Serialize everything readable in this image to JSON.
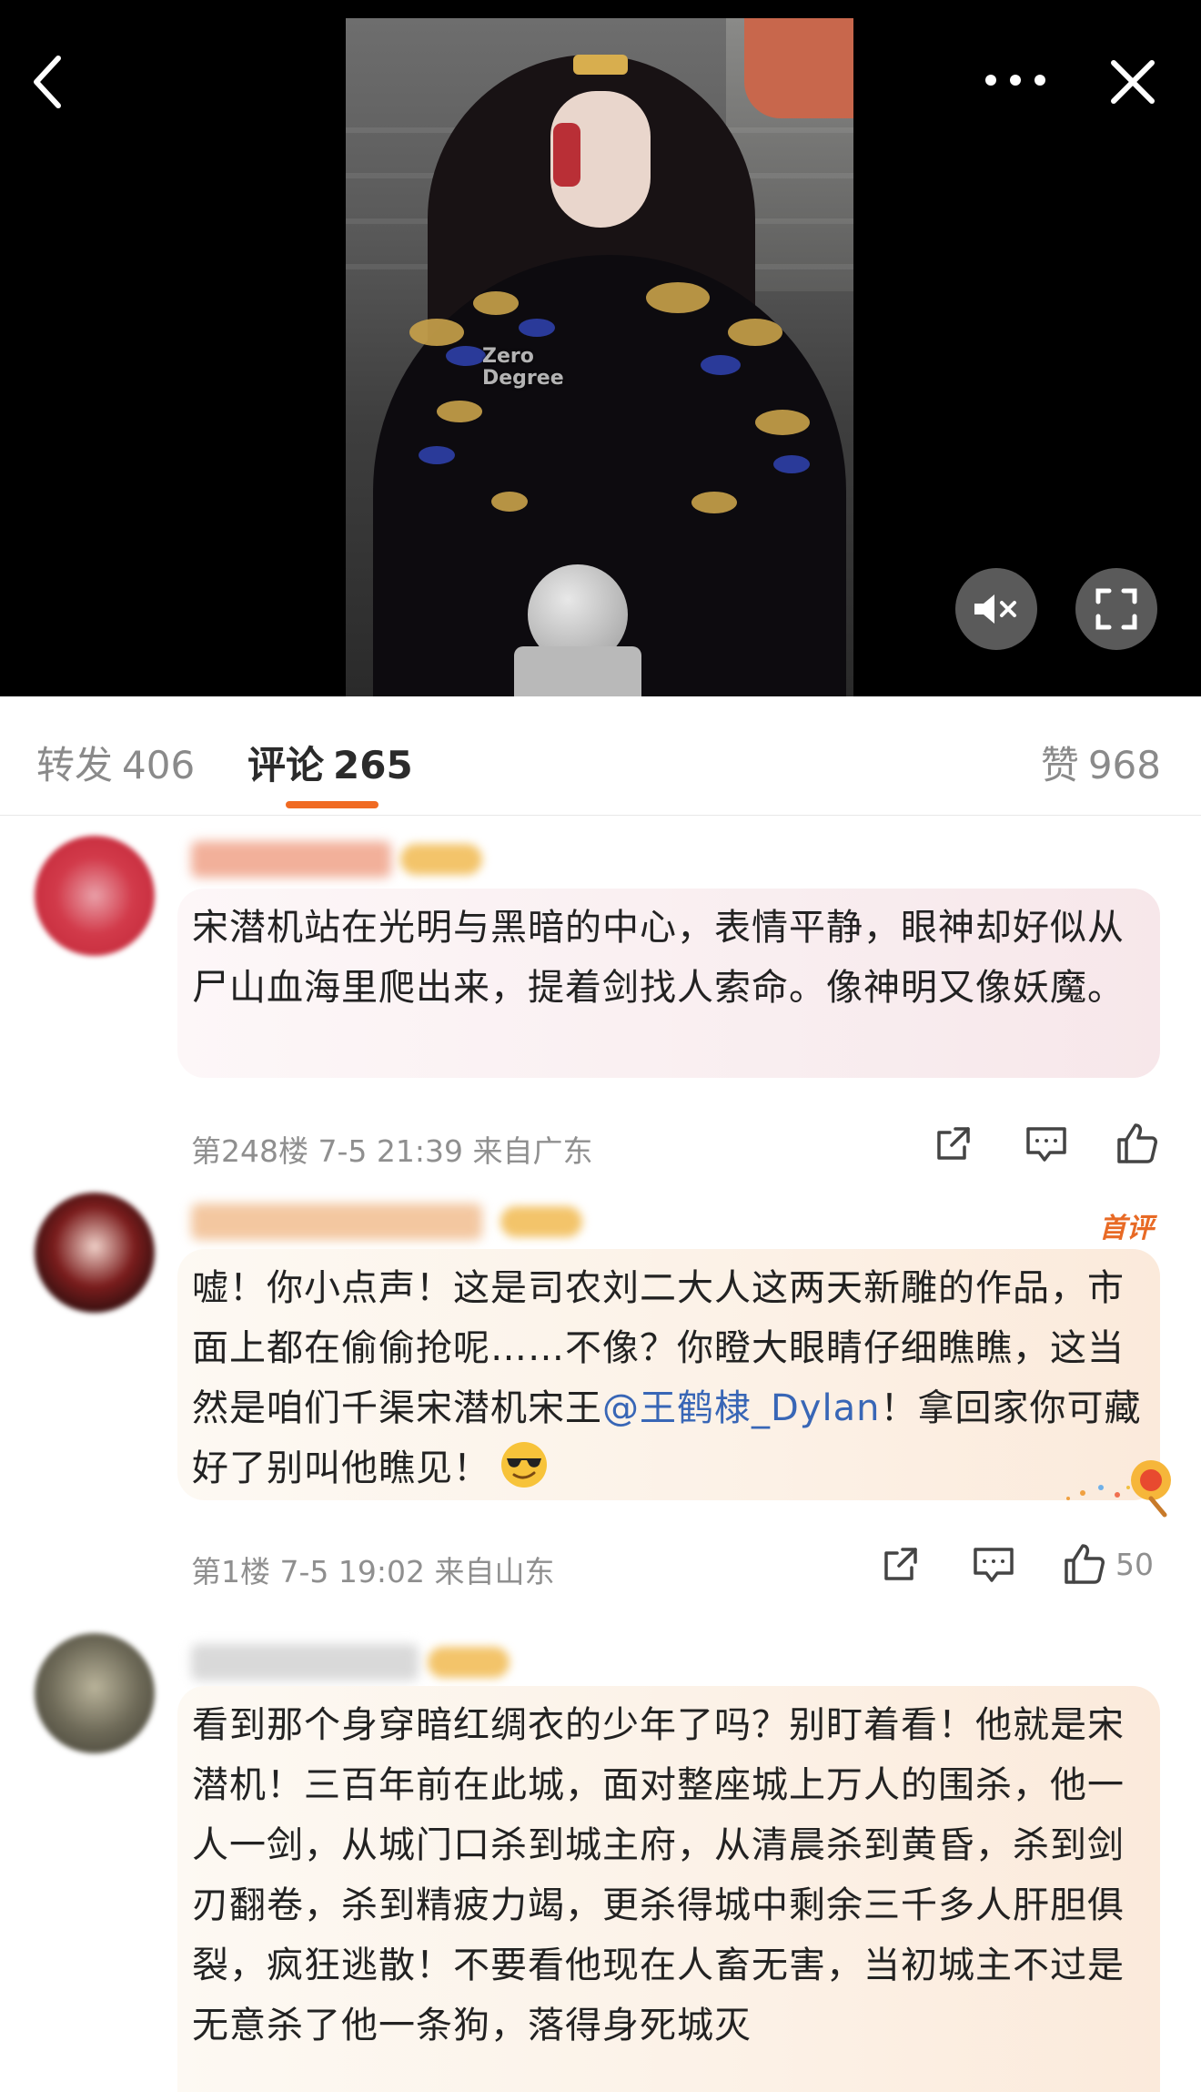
{
  "video": {
    "watermark_line1": "Zero",
    "watermark_line2": "Degree"
  },
  "tabs": [
    {
      "label": "转发",
      "count": "406"
    },
    {
      "label": "评论",
      "count": "265"
    },
    {
      "label": "赞",
      "count": "968"
    }
  ],
  "comments": [
    {
      "text": "宋潜机站在光明与黑暗的中心，表情平静，眼神却好似从尸山血海里爬出来，提着剑找人索命。像神明又像妖魔。",
      "meta": "第248楼 7-5 21:39 来自广东",
      "likes": ""
    },
    {
      "text_before": "嘘！你小点声！这是司农刘二大人这两天新雕的作品，市面上都在偷偷抢呢……不像？你瞪大眼睛仔细瞧瞧，这当然是咱们千渠宋潜机宋王",
      "mention": "@王鹤棣_Dylan",
      "text_after": "！拿回家你可藏好了别叫他瞧见！",
      "badge": "首评",
      "meta": "第1楼 7-5 19:02 来自山东",
      "likes": "50"
    },
    {
      "text": "看到那个身穿暗红绸衣的少年了吗？别盯着看！他就是宋潜机！三百年前在此城，面对整座城上万人的围杀，他一人一剑，从城门口杀到城主府，从清晨杀到黄昏，杀到剑刃翻卷，杀到精疲力竭，更杀得城中剩余三千多人肝胆俱裂，疯狂逃散！不要看他现在人畜无害，当初城主不过是无意杀了他一条狗，落得身死城灭",
      "meta": "",
      "likes": ""
    }
  ],
  "colors": {
    "accent": "#f06a22",
    "mention": "#3866b6",
    "badge": "#e86a25",
    "meta": "#8f8f8f"
  },
  "icons": [
    "back-icon",
    "more-icon",
    "close-icon",
    "mute-icon",
    "fullscreen-icon",
    "share-icon",
    "comment-icon",
    "like-icon",
    "cool-emoji-icon"
  ]
}
